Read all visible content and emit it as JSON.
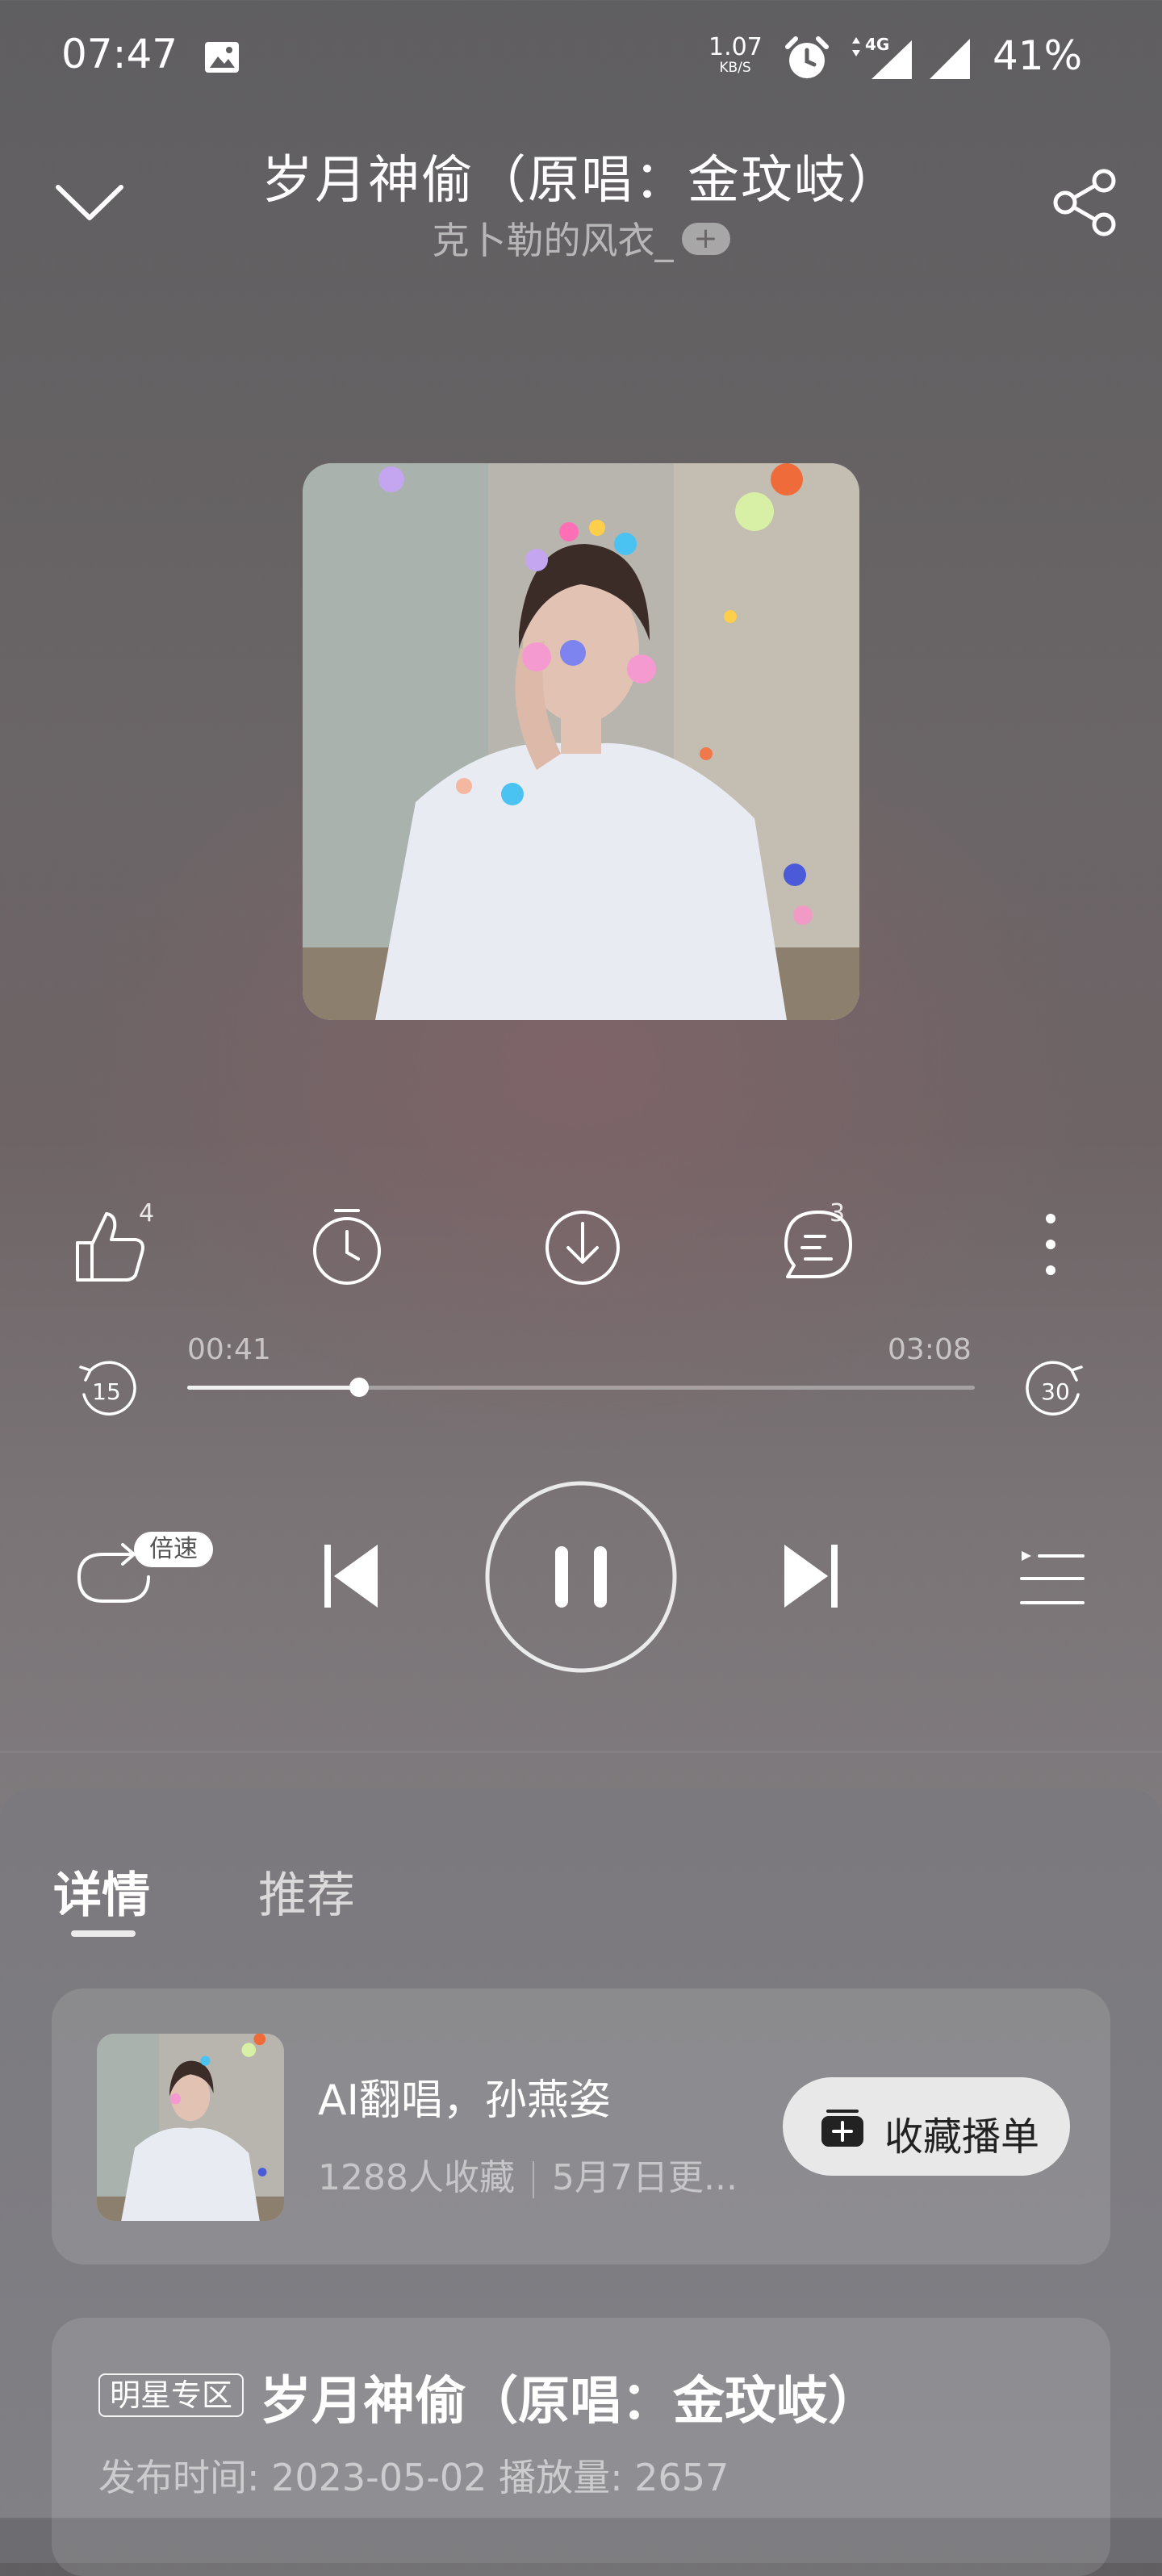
{
  "status_bar": {
    "time": "07:47",
    "net_speed_value": "1.07",
    "net_speed_unit": "KB/S",
    "network_type": "4G",
    "battery": "41%"
  },
  "header": {
    "title": "岁月神偷（原唱：金玟岐）",
    "artist": "克卜勒的风衣_",
    "follow_symbol": "+"
  },
  "actions": {
    "like_count": "4",
    "comment_count": "3"
  },
  "player": {
    "elapsed": "00:41",
    "duration": "03:08",
    "progress_fraction": 0.218,
    "rewind_seconds": "15",
    "forward_seconds": "30",
    "speed_label": "倍速"
  },
  "tabs": [
    {
      "label": "详情"
    },
    {
      "label": "推荐"
    }
  ],
  "playlist_card": {
    "title": "AI翻唱，孙燕姿",
    "collect_count": "1288人收藏",
    "update_text": "5月7日更...",
    "collect_button": "收藏播单"
  },
  "detail_card": {
    "badge": "明星专区",
    "title": "岁月神偷（原唱：金玟岐）",
    "meta": "发布时间: 2023-05-02  播放量: 2657"
  },
  "colors": {
    "accent_white": "#ffffff",
    "button_bg": "#e9e8e9"
  }
}
